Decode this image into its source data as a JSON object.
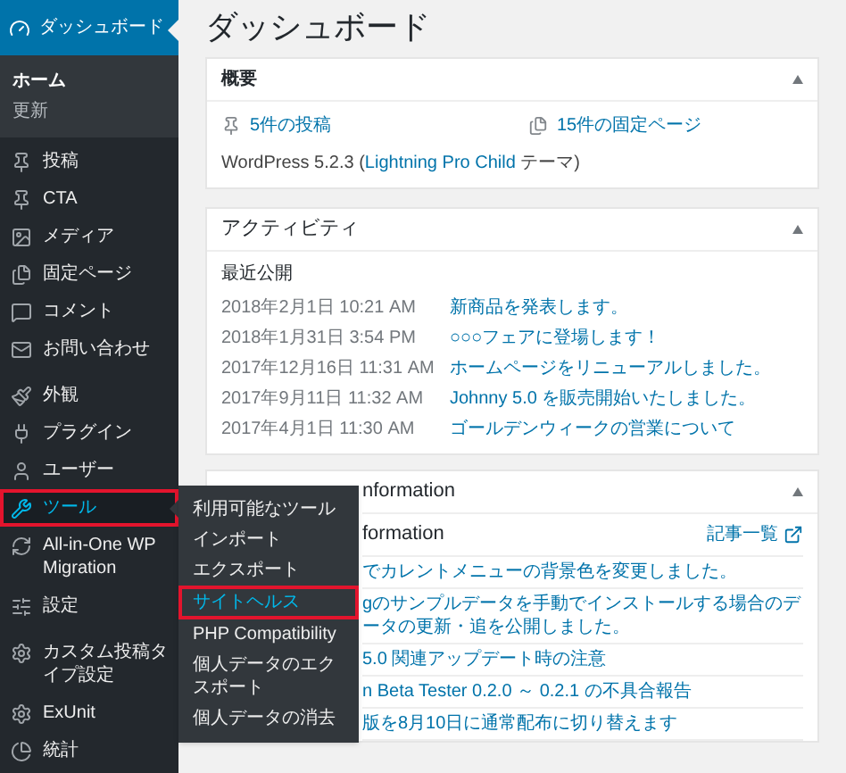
{
  "sidebar": {
    "current": {
      "label": "ダッシュボード",
      "selected": true
    },
    "submenu": [
      {
        "label": "ホーム",
        "selected": true
      },
      {
        "label": "更新",
        "selected": false
      }
    ],
    "groups": [
      [
        {
          "label": "投稿",
          "open": false,
          "highlighted": false
        },
        {
          "label": "CTA",
          "open": false,
          "highlighted": false
        },
        {
          "label": "メディア",
          "open": false,
          "highlighted": false
        },
        {
          "label": "固定ページ",
          "open": false,
          "highlighted": false
        },
        {
          "label": "コメント",
          "open": false,
          "highlighted": false
        },
        {
          "label": "お問い合わせ",
          "open": false,
          "highlighted": false
        }
      ],
      [
        {
          "label": "外観",
          "open": false,
          "highlighted": false
        },
        {
          "label": "プラグイン",
          "open": false,
          "highlighted": false
        },
        {
          "label": "ユーザー",
          "open": false,
          "highlighted": false
        },
        {
          "label": "ツール",
          "open": true,
          "highlighted": true
        },
        {
          "label": "All-in-One WP Migration",
          "open": false,
          "highlighted": false
        },
        {
          "label": "設定",
          "open": false,
          "highlighted": false
        }
      ],
      [
        {
          "label": "カスタム投稿タイプ設定",
          "open": false,
          "highlighted": false
        },
        {
          "label": "ExUnit",
          "open": false,
          "highlighted": false
        },
        {
          "label": "統計",
          "open": false,
          "highlighted": false
        }
      ]
    ]
  },
  "flyout": [
    {
      "label": "利用可能なツール",
      "selected": false,
      "highlighted": false
    },
    {
      "label": "インポート",
      "selected": false,
      "highlighted": false
    },
    {
      "label": "エクスポート",
      "selected": false,
      "highlighted": false
    },
    {
      "label": "サイトヘルス",
      "selected": true,
      "highlighted": true
    },
    {
      "label": "PHP Compatibility",
      "selected": false,
      "highlighted": false
    },
    {
      "label": "個人データのエクスポート",
      "selected": false,
      "highlighted": false
    },
    {
      "label": "個人データの消去",
      "selected": false,
      "highlighted": false
    }
  ],
  "page_title": "ダッシュボード",
  "overview": {
    "title": "概要",
    "posts": "5件の投稿",
    "pages": "15件の固定ページ",
    "version": "WordPress 5.2.3 (",
    "theme": "Lightning Pro Child",
    "theme_suffix": " テーマ)"
  },
  "activity": {
    "title": "アクティビティ",
    "subtitle": "最近公開",
    "rows": [
      {
        "date": "2018年2月1日 10:21 AM",
        "title": "新商品を発表します。"
      },
      {
        "date": "2018年1月31日 3:54 PM",
        "title": "○○○フェアに登場します！"
      },
      {
        "date": "2017年12月16日 11:31 AM",
        "title": "ホームページをリニューアルしました。"
      },
      {
        "date": "2017年9月11日 11:32 AM",
        "title": "Johnny 5.0 を販売開始いたしました。"
      },
      {
        "date": "2017年4月1日 11:30 AM",
        "title": "ゴールデンウィークの営業について"
      }
    ]
  },
  "news": {
    "title": "nformation",
    "subtitle": "formation",
    "list_link": "記事一覧",
    "rows": [
      "でカレントメニューの背景色を変更しました。",
      "gのサンプルデータを手動でインストールする場合のデータの更新・追を公開しました。",
      "5.0 関連アップデート時の注意",
      "n Beta Tester 0.2.0 ～ 0.2.1 の不具合報告",
      "版を8月10日に通常配布に切り替えます"
    ]
  }
}
